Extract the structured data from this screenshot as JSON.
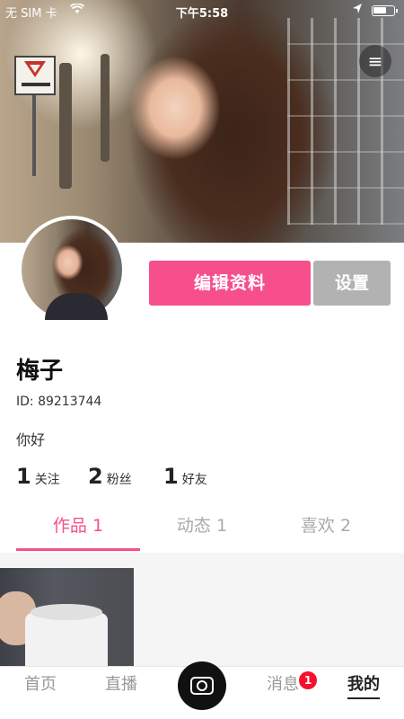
{
  "status_bar": {
    "carrier": "无 SIM 卡",
    "time": "下午5:58",
    "wifi_icon": "wifi-icon",
    "location_icon": "location-arrow-icon",
    "battery_icon": "battery-icon"
  },
  "header": {
    "menu_icon": "≡"
  },
  "profile": {
    "edit_label": "编辑资料",
    "settings_label": "设置",
    "name": "梅子",
    "id_text": "ID: 89213744",
    "bio": "你好",
    "stats": [
      {
        "count": "1",
        "label": "关注"
      },
      {
        "count": "2",
        "label": "粉丝"
      },
      {
        "count": "1",
        "label": "好友"
      }
    ]
  },
  "tabs": [
    {
      "label": "作品 1",
      "active": true
    },
    {
      "label": "动态 1",
      "active": false
    },
    {
      "label": "喜欢 2",
      "active": false
    }
  ],
  "bottom_nav": {
    "items": [
      {
        "label": "首页"
      },
      {
        "label": "直播"
      },
      {
        "label": "消息"
      },
      {
        "label": "我的"
      }
    ],
    "messages_badge": "1"
  },
  "colors": {
    "accent": "#f64f8b",
    "settings_button": "#b2b2b2",
    "badge": "#f5112e"
  }
}
